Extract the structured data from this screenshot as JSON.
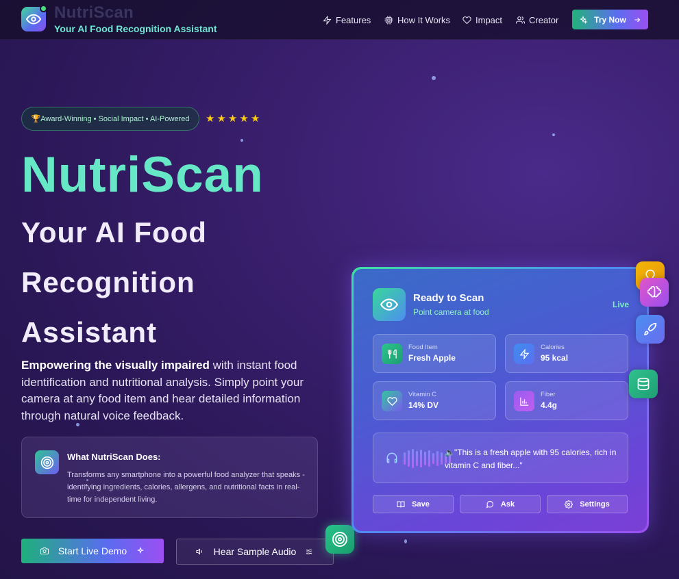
{
  "brand": {
    "name": "NutriScan",
    "tagline": "Your AI Food Recognition Assistant"
  },
  "nav": {
    "items": [
      {
        "label": "Features",
        "icon": "zap-icon"
      },
      {
        "label": "How It Works",
        "icon": "cpu-icon"
      },
      {
        "label": "Impact",
        "icon": "heart-icon"
      },
      {
        "label": "Creator",
        "icon": "users-icon"
      }
    ],
    "cta": "Try Now"
  },
  "hero": {
    "badge": "🏆Award-Winning • Social Impact • AI-Powered",
    "stars": [
      "★",
      "★",
      "★",
      "★",
      "★"
    ],
    "title": "NutriScan",
    "subtitle_lines": [
      "Your AI Food",
      "Recognition",
      "Assistant"
    ],
    "desc_bold": "Empowering the visually impaired",
    "desc_rest": " with instant food identification and nutritional analysis. Simply point your camera at any food item and hear detailed information through natural voice feedback."
  },
  "what": {
    "title": "What NutriScan Does:",
    "text": "Transforms any smartphone into a powerful food analyzer that speaks - identifying ingredients, calories, allergens, and nutritional facts in real-time for independent living."
  },
  "buttons": {
    "demo": "Start Live Demo",
    "audio": "Hear Sample Audio"
  },
  "device": {
    "status_title": "Ready to Scan",
    "status_sub": "Point camera at food",
    "live": "Live",
    "stats": [
      {
        "label": "Food Item",
        "value": "Fresh Apple",
        "icon": "utensils-icon",
        "color_from": "#2bc48a",
        "color_to": "#1f9e74"
      },
      {
        "label": "Calories",
        "value": "95 kcal",
        "icon": "zap-icon",
        "color_from": "#3f8df0",
        "color_to": "#5b6ff0"
      },
      {
        "label": "Vitamin C",
        "value": "14% DV",
        "icon": "heart-icon",
        "color_from": "#30c79a",
        "color_to": "#7a5cf0"
      },
      {
        "label": "Fiber",
        "value": "4.4g",
        "icon": "bar-chart-icon",
        "color_from": "#9a5cf0",
        "color_to": "#c05ef0"
      }
    ],
    "voice_text": "\"This is a fresh apple with 95 calories, rich in vitamin C and fiber...\"",
    "actions": [
      {
        "label": "Save",
        "icon": "book-icon"
      },
      {
        "label": "Ask",
        "icon": "message-icon"
      },
      {
        "label": "Settings",
        "icon": "gear-icon"
      }
    ]
  },
  "colors": {
    "accent_green": "#66e7c6",
    "accent_purple": "#9d4ff2",
    "star": "#facc15"
  }
}
